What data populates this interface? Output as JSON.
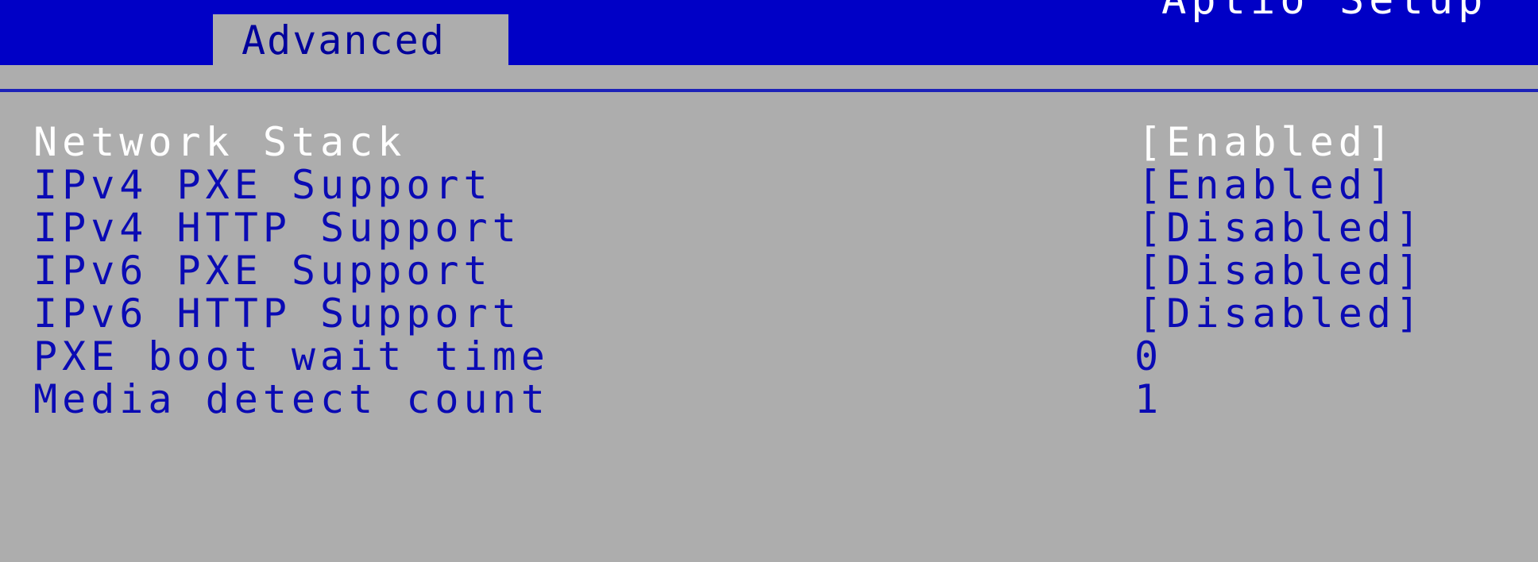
{
  "header": {
    "app_title": "Aptio Setup",
    "active_tab": "Advanced"
  },
  "colors": {
    "header_bg": "#0000c6",
    "panel_bg": "#adadad",
    "item_text": "#0a0ab4",
    "selected_text": "#ffffff"
  },
  "settings": [
    {
      "label": "Network Stack",
      "value": "[Enabled]",
      "selected": true
    },
    {
      "label": "IPv4 PXE Support",
      "value": "[Enabled]",
      "selected": false
    },
    {
      "label": "IPv4 HTTP Support",
      "value": "[Disabled]",
      "selected": false
    },
    {
      "label": "IPv6 PXE Support",
      "value": "[Disabled]",
      "selected": false
    },
    {
      "label": "IPv6 HTTP Support",
      "value": "[Disabled]",
      "selected": false
    },
    {
      "label": "PXE boot wait time",
      "value": "0",
      "selected": false
    },
    {
      "label": "Media detect count",
      "value": "1",
      "selected": false
    }
  ]
}
